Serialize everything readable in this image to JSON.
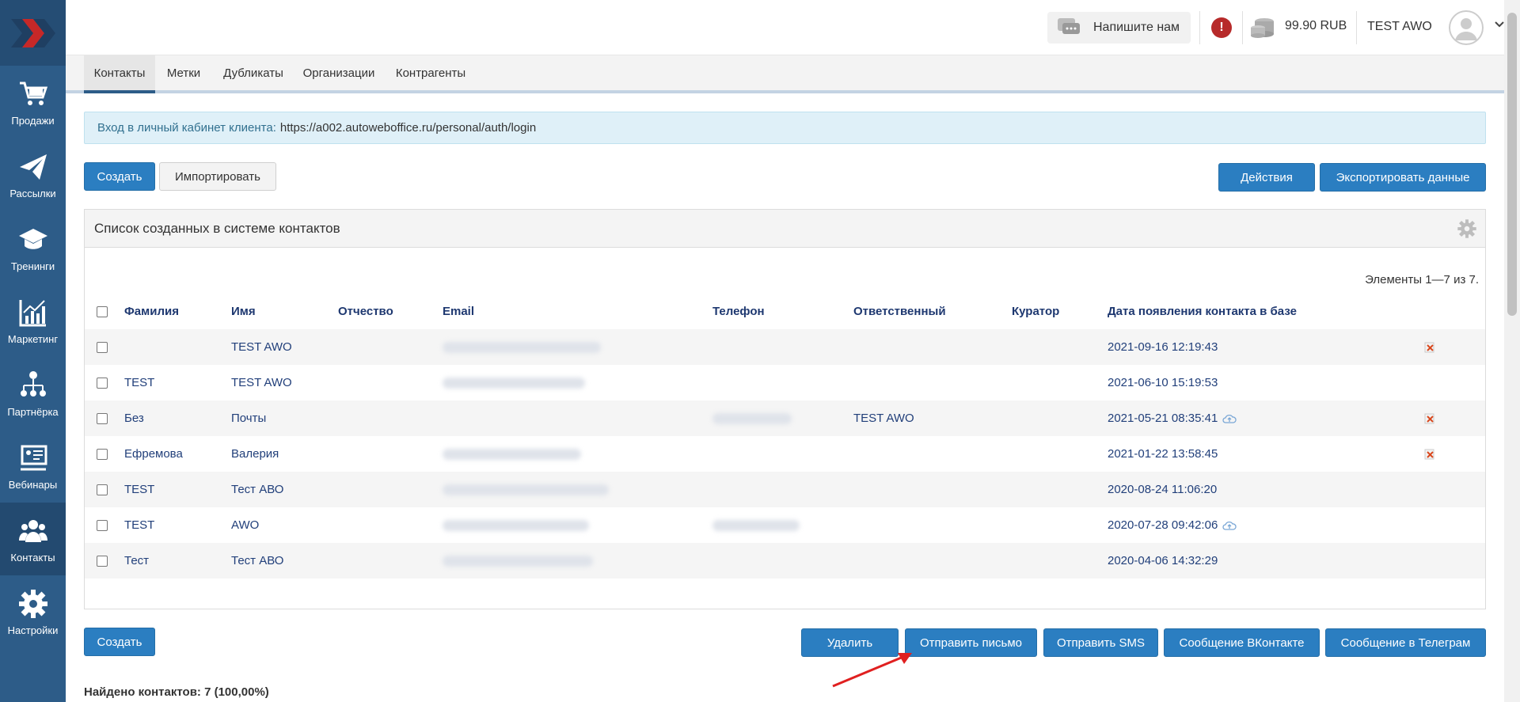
{
  "sidebar": {
    "items": [
      {
        "label": "Продажи",
        "icon": "cart-icon"
      },
      {
        "label": "Рассылки",
        "icon": "paper-plane-icon"
      },
      {
        "label": "Тренинги",
        "icon": "graduation-cap-icon"
      },
      {
        "label": "Маркетинг",
        "icon": "chart-icon"
      },
      {
        "label": "Партнёрка",
        "icon": "network-icon"
      },
      {
        "label": "Вебинары",
        "icon": "presentation-icon"
      },
      {
        "label": "Контакты",
        "icon": "users-icon"
      },
      {
        "label": "Настройки",
        "icon": "gear-icon"
      }
    ]
  },
  "topbar": {
    "write_us": "Напишите нам",
    "balance": "99.90 RUB",
    "username": "TEST AWO"
  },
  "tabs": [
    "Контакты",
    "Метки",
    "Дубликаты",
    "Организации",
    "Контрагенты"
  ],
  "info": {
    "label": "Вход в личный кабинет клиента:",
    "url": "https://a002.autoweboffice.ru/personal/auth/login"
  },
  "toolbar": {
    "create": "Создать",
    "import": "Импортировать",
    "actions": "Действия",
    "export": "Экспортировать данные"
  },
  "panel": {
    "title": "Список созданных в системе контактов",
    "count": "Элементы 1—7 из 7."
  },
  "table": {
    "headers": [
      "Фамилия",
      "Имя",
      "Отчество",
      "Email",
      "Телефон",
      "Ответственный",
      "Куратор",
      "Дата появления контакта в базе"
    ],
    "rows": [
      {
        "last": "",
        "first": "TEST AWO",
        "resp": "",
        "date": "2021-09-16 12:19:43"
      },
      {
        "last": "TEST",
        "first": "TEST AWO",
        "resp": "",
        "date": "2021-06-10 15:19:53"
      },
      {
        "last": "Без",
        "first": "Почты",
        "resp": "TEST AWO",
        "date": "2021-05-21 08:35:41"
      },
      {
        "last": "Ефремова",
        "first": "Валерия",
        "resp": "",
        "date": "2021-01-22 13:58:45"
      },
      {
        "last": "TEST",
        "first": "Тест АВО",
        "resp": "",
        "date": "2020-08-24 11:06:20"
      },
      {
        "last": "TEST",
        "first": "AWO",
        "resp": "",
        "date": "2020-07-28 09:42:06"
      },
      {
        "last": "Тест",
        "first": "Тест АВО",
        "resp": "",
        "date": "2020-04-06 14:32:29"
      }
    ]
  },
  "bottom": {
    "create": "Создать",
    "delete": "Удалить",
    "send_email": "Отправить письмо",
    "send_sms": "Отправить SMS",
    "vk": "Сообщение ВКонтакте",
    "telegram": "Сообщение в Телеграм",
    "found": "Найдено контактов: 7 (100,00%)"
  },
  "colors": {
    "sidebar": "#2d5c88",
    "primary": "#2b7ec1",
    "alert": "#b72a2a",
    "annotation_arrow": "#e02020"
  }
}
